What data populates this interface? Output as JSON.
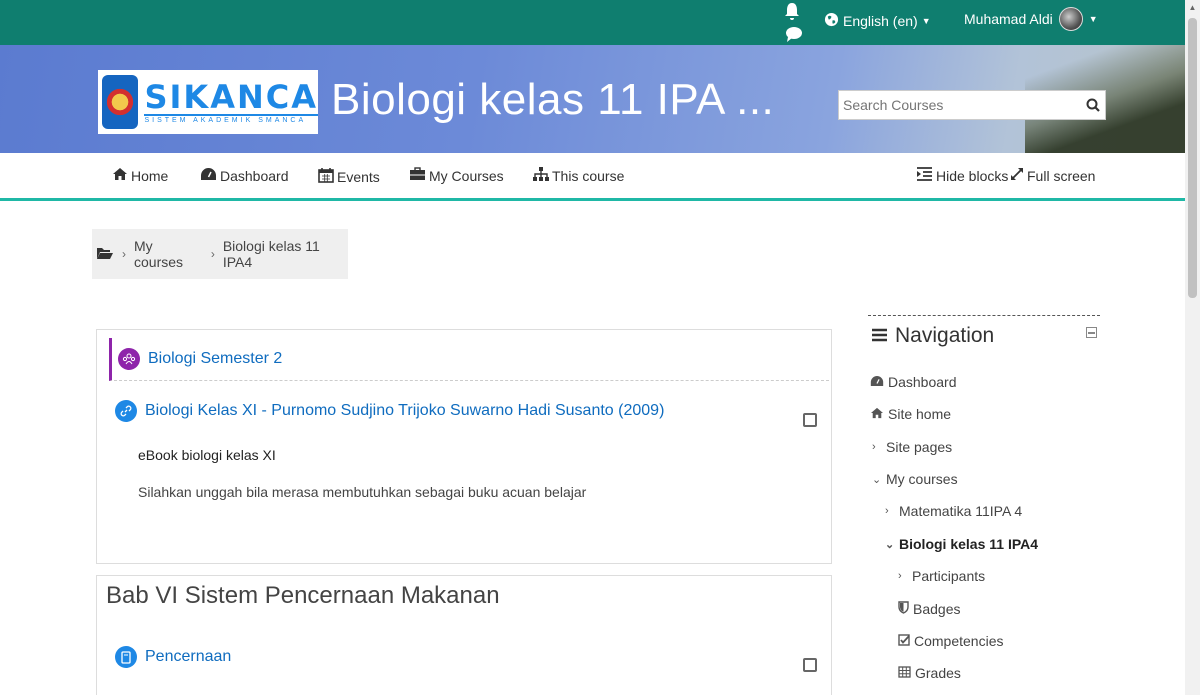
{
  "topbar": {
    "language": "English (en)",
    "user_name": "Muhamad Aldi"
  },
  "banner": {
    "logo_name": "SIKANCA",
    "logo_sub": "SISTEM AKADEMIK SMANCA",
    "title": "Biologi kelas 11 IPA ...",
    "search_placeholder": "Search Courses"
  },
  "navbar": {
    "home": "Home",
    "dashboard": "Dashboard",
    "events": "Events",
    "my_courses": "My Courses",
    "this_course": "This course",
    "hide_blocks": "Hide blocks",
    "full_screen": "Full screen"
  },
  "breadcrumb": {
    "items": [
      "My courses",
      "Biologi kelas 11 IPA4"
    ]
  },
  "section1": {
    "header_link": "Biologi Semester 2",
    "activity_link": "Biologi Kelas XI - Purnomo Sudjino Trijoko Suwarno Hadi Susanto (2009)",
    "desc_bold": "eBook biologi kelas XI",
    "desc": "Silahkan unggah bila merasa membutuhkan sebagai buku acuan belajar"
  },
  "section2": {
    "title": "Bab VI Sistem Pencernaan Makanan",
    "activity_link": "Pencernaan"
  },
  "navigation": {
    "title": "Navigation",
    "items": [
      "Dashboard",
      "Site home",
      "Site pages",
      "My courses",
      "Matematika 11IPA 4",
      "Biologi kelas 11 IPA4",
      "Participants",
      "Badges",
      "Competencies",
      "Grades"
    ]
  },
  "colors": {
    "topbar": "#0f7e6f",
    "accent_line": "#1fb8a6",
    "link": "#0f6cbf",
    "section_highlight": "#8e24aa"
  }
}
